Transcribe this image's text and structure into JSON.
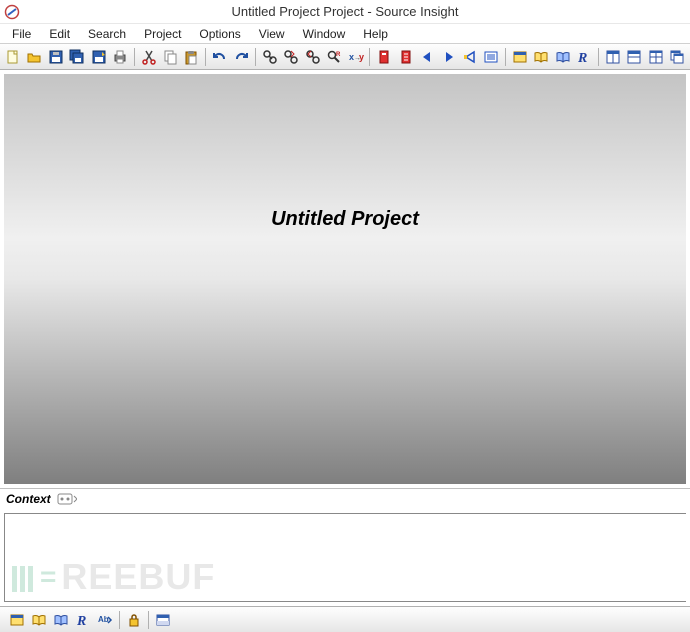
{
  "title": "Untitled Project Project - Source Insight",
  "menu": {
    "file": "File",
    "edit": "Edit",
    "search": "Search",
    "project": "Project",
    "options": "Options",
    "view": "View",
    "window": "Window",
    "help": "Help"
  },
  "editor": {
    "heading": "Untitled Project"
  },
  "context": {
    "label": "Context"
  },
  "watermark": "REEBUF",
  "toolbar_icons": {
    "new": "new-file-icon",
    "open": "open-folder-icon",
    "save": "save-icon",
    "saveall": "save-all-icon",
    "saveas": "save-as-icon",
    "print": "print-icon",
    "cut": "cut-icon",
    "copy": "copy-icon",
    "paste": "paste-icon",
    "undo": "undo-icon",
    "redo": "redo-icon",
    "find": "find-icon",
    "findnext": "find-next-icon",
    "findprev": "find-prev-icon",
    "replace": "replace-icon",
    "rename": "rename-icon",
    "bookmark1": "bookmark-red-icon",
    "bookmark2": "bookmark-red2-icon",
    "navback": "nav-back-icon",
    "navfwd": "nav-forward-icon",
    "navup": "nav-up-icon",
    "navlist": "nav-list-icon",
    "window1": "window-yellow-icon",
    "book1": "book-open-icon",
    "book2": "book-blue-icon",
    "script": "script-r-icon",
    "tile1": "tile-horiz-icon",
    "tile2": "tile-vert-icon",
    "tile3": "tile-grid-icon",
    "tile4": "tile-cascade-icon"
  },
  "bottombar_icons": {
    "b1": "window-yellow-icon",
    "b2": "book-open-icon",
    "b3": "book-blue-icon",
    "b4": "script-r-icon",
    "b5": "ab-arrow-icon",
    "b6": "lock-icon",
    "b7": "panel-icon"
  }
}
